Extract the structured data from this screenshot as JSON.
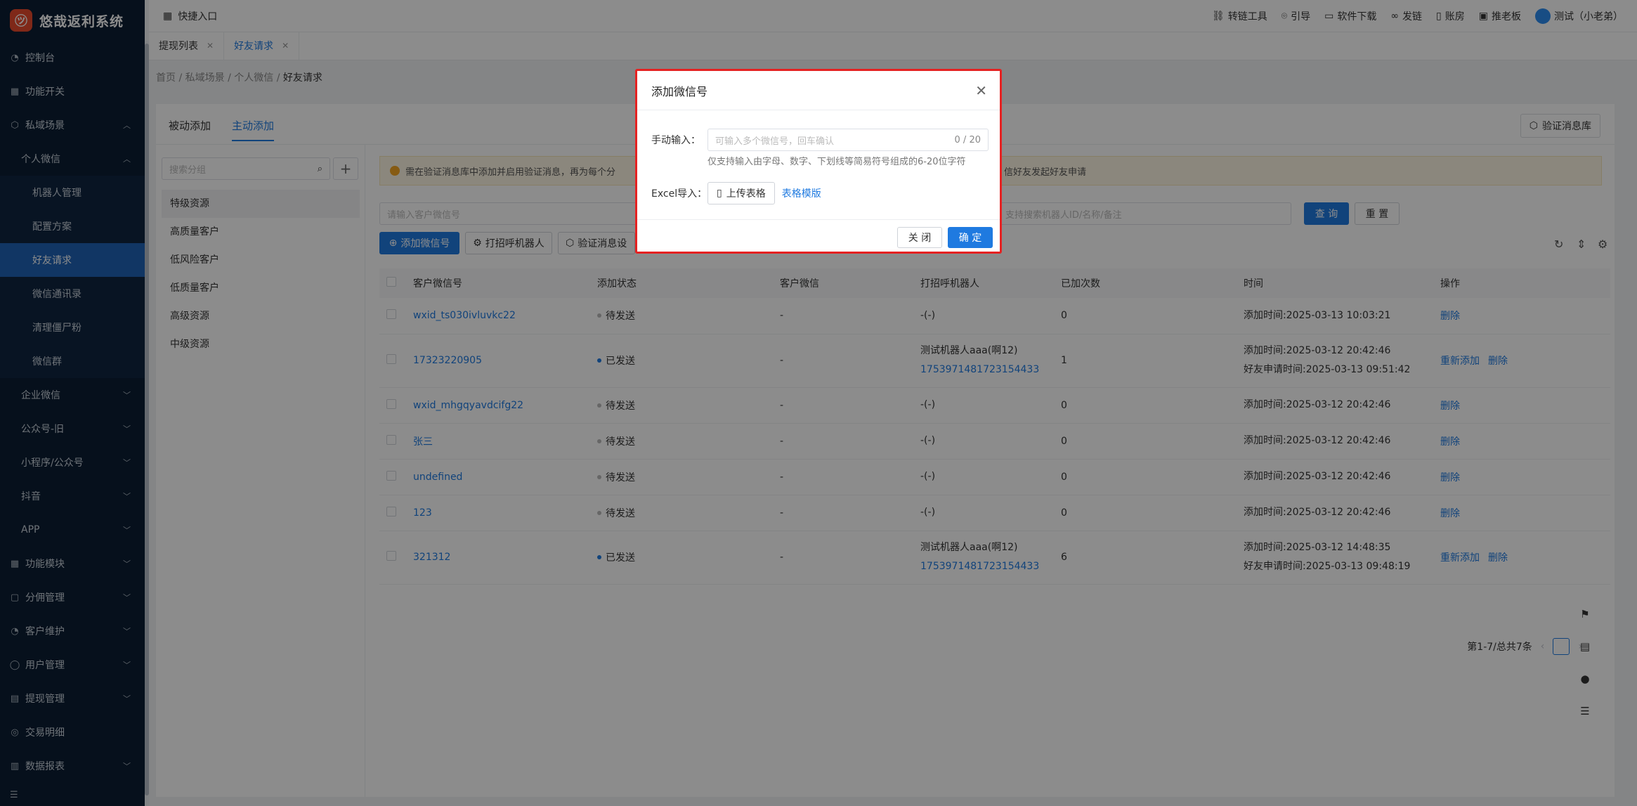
{
  "app": {
    "title": "悠哉返利系统",
    "logo_glyph": "㋡"
  },
  "sidebar": {
    "items": [
      {
        "label": "控制台",
        "icon": "dashboard-icon",
        "level": 0
      },
      {
        "label": "功能开关",
        "icon": "grid-icon",
        "level": 0
      },
      {
        "label": "私域场景",
        "icon": "box-icon",
        "level": 0,
        "expanded": true
      },
      {
        "label": "个人微信",
        "level": 1,
        "expanded": true
      },
      {
        "label": "机器人管理",
        "level": 2
      },
      {
        "label": "配置方案",
        "level": 2
      },
      {
        "label": "好友请求",
        "level": 2,
        "active": true
      },
      {
        "label": "微信通讯录",
        "level": 2
      },
      {
        "label": "清理僵尸粉",
        "level": 2
      },
      {
        "label": "微信群",
        "level": 2
      },
      {
        "label": "企业微信",
        "level": 1,
        "collapsed": true
      },
      {
        "label": "公众号-旧",
        "level": 1,
        "collapsed": true
      },
      {
        "label": "小程序/公众号",
        "level": 1,
        "collapsed": true
      },
      {
        "label": "抖音",
        "level": 1,
        "collapsed": true
      },
      {
        "label": "APP",
        "level": 1,
        "collapsed": true
      },
      {
        "label": "功能模块",
        "icon": "module-icon",
        "level": 0,
        "collapsed": true
      },
      {
        "label": "分佣管理",
        "icon": "commission-icon",
        "level": 0,
        "collapsed": true
      },
      {
        "label": "客户维护",
        "icon": "customer-icon",
        "level": 0,
        "collapsed": true
      },
      {
        "label": "用户管理",
        "icon": "user-icon",
        "level": 0,
        "collapsed": true
      },
      {
        "label": "提现管理",
        "icon": "withdraw-icon",
        "level": 0,
        "collapsed": true
      },
      {
        "label": "交易明细",
        "icon": "trade-icon",
        "level": 0
      },
      {
        "label": "数据报表",
        "icon": "chart-icon",
        "level": 0,
        "collapsed": true
      }
    ]
  },
  "topbar": {
    "quick_entry": "快捷入口",
    "links": [
      "转链工具",
      "引导",
      "软件下载",
      "发链",
      "账房",
      "推老板"
    ],
    "user": "测试（小老弟）"
  },
  "tabs": [
    {
      "label": "提现列表",
      "active": false
    },
    {
      "label": "好友请求",
      "active": true
    }
  ],
  "breadcrumb": [
    "首页",
    "私域场景",
    "个人微信",
    "好友请求"
  ],
  "subtabs": [
    "被动添加",
    "主动添加"
  ],
  "verify_lib_button": "验证消息库",
  "groups": {
    "search_placeholder": "搜索分组",
    "items": [
      "特级资源",
      "高质量客户",
      "低风险客户",
      "低质量客户",
      "高级资源",
      "中级资源"
    ]
  },
  "notice": {
    "text": "需在验证消息库中添加并启用验证消息，再为每个分",
    "tail": "信好友发起好友申请"
  },
  "filters": {
    "wx_placeholder": "请输入客户微信号",
    "robot_placeholder": "支持搜索机器人ID/名称/备注",
    "query": "查 询",
    "reset": "重 置"
  },
  "actions": {
    "add": "添加微信号",
    "robot": "打招呼机器人",
    "verify": "验证消息设"
  },
  "table": {
    "columns": [
      "客户微信号",
      "添加状态",
      "客户微信",
      "打招呼机器人",
      "已加次数",
      "时间",
      "操作"
    ],
    "rows": [
      {
        "wx": "wxid_ts030ivluvkc22",
        "status": "待发送",
        "sent": false,
        "customer": "-",
        "robot": "-(-)",
        "robot_id": "",
        "count": "0",
        "times": [
          "添加时间:2025-03-13 10:03:21"
        ],
        "ops": [
          "删除"
        ]
      },
      {
        "wx": "17323220905",
        "status": "已发送",
        "sent": true,
        "customer": "-",
        "robot": "测试机器人aaa(啊12)",
        "robot_id": "1753971481723154433",
        "count": "1",
        "times": [
          "添加时间:2025-03-12 20:42:46",
          "好友申请时间:2025-03-13 09:51:42"
        ],
        "ops": [
          "重新添加",
          "删除"
        ]
      },
      {
        "wx": "wxid_mhgqyavdcifg22",
        "status": "待发送",
        "sent": false,
        "customer": "-",
        "robot": "-(-)",
        "robot_id": "",
        "count": "0",
        "times": [
          "添加时间:2025-03-12 20:42:46"
        ],
        "ops": [
          "删除"
        ]
      },
      {
        "wx": "张三",
        "status": "待发送",
        "sent": false,
        "customer": "-",
        "robot": "-(-)",
        "robot_id": "",
        "count": "0",
        "times": [
          "添加时间:2025-03-12 20:42:46"
        ],
        "ops": [
          "删除"
        ]
      },
      {
        "wx": "undefined",
        "status": "待发送",
        "sent": false,
        "customer": "-",
        "robot": "-(-)",
        "robot_id": "",
        "count": "0",
        "times": [
          "添加时间:2025-03-12 20:42:46"
        ],
        "ops": [
          "删除"
        ]
      },
      {
        "wx": "123",
        "status": "待发送",
        "sent": false,
        "customer": "-",
        "robot": "-(-)",
        "robot_id": "",
        "count": "0",
        "times": [
          "添加时间:2025-03-12 20:42:46"
        ],
        "ops": [
          "删除"
        ]
      },
      {
        "wx": "321312",
        "status": "已发送",
        "sent": true,
        "customer": "-",
        "robot": "测试机器人aaa(啊12)",
        "robot_id": "1753971481723154433",
        "count": "6",
        "times": [
          "添加时间:2025-03-12 14:48:35",
          "好友申请时间:2025-03-13 09:48:19"
        ],
        "ops": [
          "重新添加",
          "删除"
        ]
      }
    ]
  },
  "pagination": {
    "summary": "第1-7/总共7条"
  },
  "modal": {
    "title": "添加微信号",
    "manual_label": "手动输入：",
    "manual_placeholder": "可输入多个微信号，回车确认",
    "manual_count": "0 / 20",
    "hint": "仅支持输入由字母、数字、下划线等简易符号组成的6-20位字符",
    "excel_label": "Excel导入：",
    "upload": "上传表格",
    "template": "表格模版",
    "cancel": "关 闭",
    "ok": "确 定"
  },
  "colors": {
    "primary": "#1f7ae0",
    "sidebar": "#0b1e33",
    "highlight": "#e52222"
  }
}
